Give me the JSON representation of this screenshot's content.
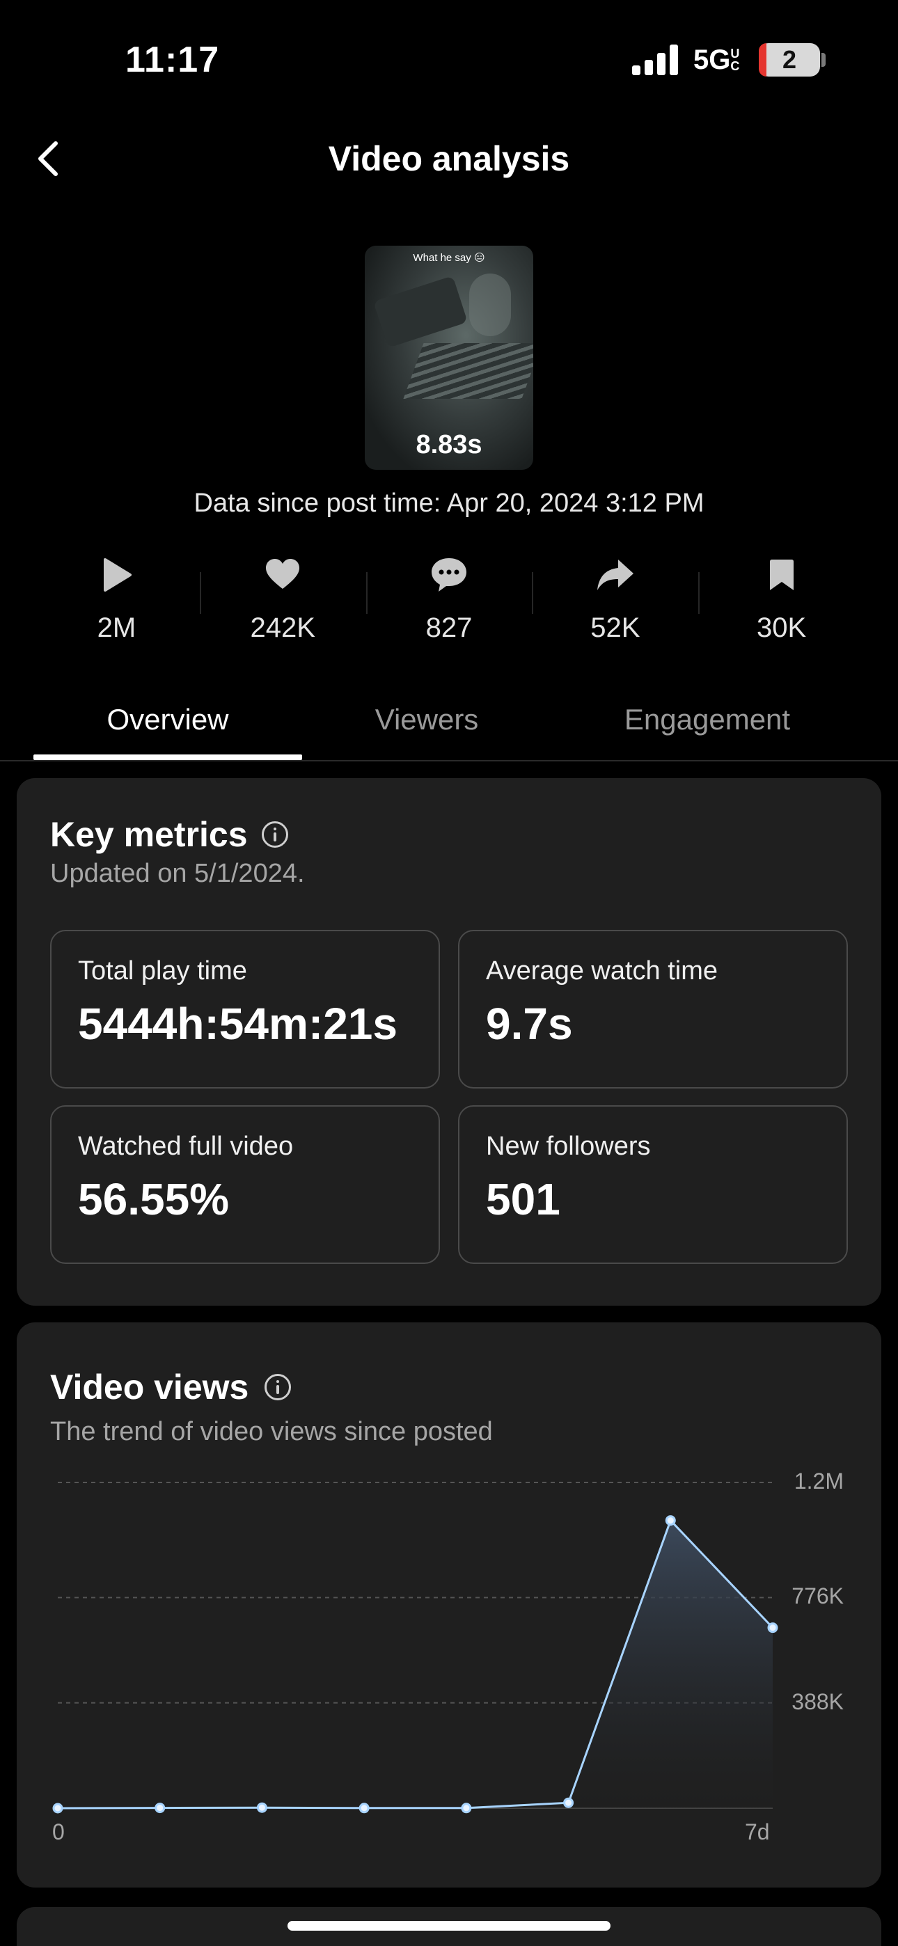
{
  "status_bar": {
    "time": "11:17",
    "network": "5G",
    "network_suffix": "UC",
    "battery": "2",
    "battery_level": 0.02
  },
  "header": {
    "back_icon": "chevron-left-icon",
    "title": "Video analysis"
  },
  "video": {
    "caption": "What he say 😑",
    "duration": "8.83s",
    "data_since": "Data since post time: Apr 20, 2024 3:12 PM"
  },
  "stats": [
    {
      "icon": "play-icon",
      "value": "2M"
    },
    {
      "icon": "heart-icon",
      "value": "242K"
    },
    {
      "icon": "comment-icon",
      "value": "827"
    },
    {
      "icon": "share-icon",
      "value": "52K"
    },
    {
      "icon": "bookmark-icon",
      "value": "30K"
    }
  ],
  "tabs": {
    "overview": "Overview",
    "viewers": "Viewers",
    "engagement": "Engagement",
    "selected": "Overview"
  },
  "key_metrics": {
    "title": "Key metrics",
    "updated": "Updated on 5/1/2024.",
    "items": [
      {
        "label": "Total play time",
        "value": "5444h:54m:21s"
      },
      {
        "label": "Average watch time",
        "value": "9.7s"
      },
      {
        "label": "Watched full video",
        "value": "56.55%"
      },
      {
        "label": "New followers",
        "value": "501"
      }
    ]
  },
  "video_views": {
    "title": "Video views",
    "subtitle": "The trend of video views since posted"
  },
  "chart_data": {
    "type": "area",
    "x": [
      0,
      1,
      2,
      3,
      4,
      5,
      6,
      7
    ],
    "x_tick_labels": [
      "0",
      "7d"
    ],
    "values": [
      0,
      1000,
      2000,
      500,
      600,
      20000,
      1060000,
      665000
    ],
    "ylim": [
      0,
      1200000
    ],
    "y_ticks": [
      {
        "value": 388000,
        "label": "388K"
      },
      {
        "value": 776000,
        "label": "776K"
      },
      {
        "value": 1200000,
        "label": "1.2M"
      }
    ],
    "grid": true,
    "line_color": "#a8d4ff",
    "title": "",
    "xlabel": "",
    "ylabel": ""
  },
  "colors": {
    "background": "#000000",
    "card": "#1f1f1f",
    "line": "#a8d4ff"
  }
}
